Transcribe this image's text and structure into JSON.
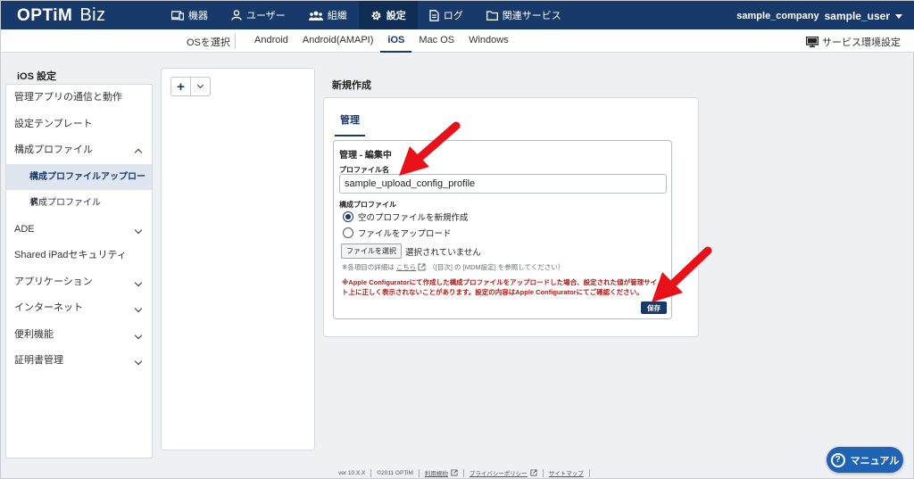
{
  "header": {
    "logo_bold": "OPTiM",
    "logo_thin": "Biz",
    "nav": [
      {
        "label": "機器",
        "icon": "device-icon"
      },
      {
        "label": "ユーザー",
        "icon": "user-icon"
      },
      {
        "label": "組織",
        "icon": "group-icon"
      },
      {
        "label": "設定",
        "icon": "gear-icon",
        "active": true
      },
      {
        "label": "ログ",
        "icon": "log-icon"
      },
      {
        "label": "関連サービス",
        "icon": "folder-icon"
      }
    ],
    "company": "sample_company",
    "user": "sample_user"
  },
  "osbar": {
    "select_label": "OSを選択",
    "tabs": [
      "Android",
      "Android(AMAPI)",
      "iOS",
      "Mac OS",
      "Windows"
    ],
    "active_tab": "iOS",
    "service_env": "サービス環境設定"
  },
  "sidebar": {
    "title": "iOS 設定",
    "items": [
      {
        "label": "管理アプリの通信と動作"
      },
      {
        "label": "設定テンプレート"
      },
      {
        "label": "構成プロファイル",
        "expanded": true
      },
      {
        "label": "構成プロファイルアップロード",
        "sub": true,
        "active": true
      },
      {
        "label": "構成プロファイル",
        "sub": true
      },
      {
        "label": "ADE",
        "chevron": true
      },
      {
        "label": "Shared iPadセキュリティ"
      },
      {
        "label": "アプリケーション",
        "chevron": true
      },
      {
        "label": "インターネット",
        "chevron": true
      },
      {
        "label": "便利機能",
        "chevron": true
      },
      {
        "label": "証明書管理",
        "chevron": true
      }
    ]
  },
  "main": {
    "title": "新規作成",
    "tab": "管理",
    "edit_title": "管理 - 編集中",
    "profile_name_label": "プロファイル名",
    "profile_name_value": "sample_upload_config_profile",
    "config_label": "構成プロファイル",
    "radio_new": "空のプロファイルを新規作成",
    "radio_upload": "ファイルをアップロード",
    "file_button": "ファイルを選択",
    "file_status": "選択されていません",
    "note_prefix": "※各項目の詳細は",
    "note_link": "こちら",
    "note_suffix": "（[目次] の [MDM設定] を参照してください）",
    "warning": "※Apple Configuratorにて作成した構成プロファイルをアップロードした場合、設定された値が管理サイト上に正しく表示されないことがあります。設定の内容はApple Configuratorにてご確認ください。",
    "save": "保存"
  },
  "footer": {
    "version": "ver 10.X.X",
    "copyright": "©2011 OPTiM",
    "links": [
      "利用規約",
      "プライバシーポリシー",
      "サイトマップ"
    ]
  },
  "manual_button": "マニュアル",
  "colors": {
    "navy": "#173a6b",
    "warning_red": "#b51818",
    "arrow_red": "#e8111a",
    "manual_blue": "#1f63b5"
  }
}
